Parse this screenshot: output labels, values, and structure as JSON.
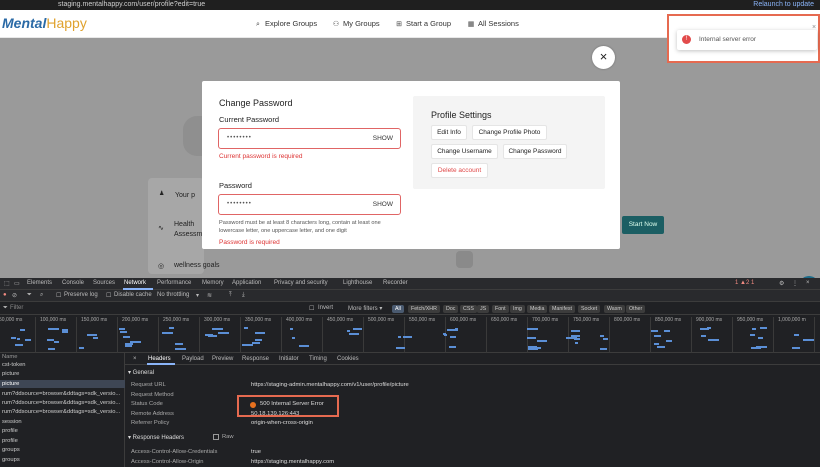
{
  "browser": {
    "url": "staging.mentalhappy.com/user/profile?edit=true",
    "relaunch": "Relaunch to update"
  },
  "site": {
    "logo_main": "Mental",
    "logo_accent": "Happy",
    "nav": [
      {
        "label": "Explore Groups",
        "icon": "search-icon"
      },
      {
        "label": "My Groups",
        "icon": "people-icon"
      },
      {
        "label": "Start a Group",
        "icon": "plus-square-icon"
      },
      {
        "label": "All Sessions",
        "icon": "calendar-icon"
      }
    ],
    "background": {
      "your_label": "Your p",
      "health_label_1": "Health",
      "health_label_2": "Assessm",
      "wellness_label": "wellness goals",
      "start_now": "Start Now"
    }
  },
  "modal": {
    "title": "Change Password",
    "current_password_label": "Current Password",
    "current_password_value": "••••••••",
    "show_label": "SHOW",
    "current_password_error": "Current password is required",
    "password_label": "Password",
    "password_value": "••••••••",
    "password_hint": "Password must be at least 8 characters long, contain at least one lowercase letter, one uppercase letter, and one digit",
    "password_error": "Password is required"
  },
  "profile_settings": {
    "title": "Profile Settings",
    "buttons": [
      "Edit Info",
      "Change Profile Photo",
      "Change Username",
      "Change Password",
      "Delete account"
    ]
  },
  "toast": {
    "message": "Internal server error",
    "icon": "!",
    "close": "×"
  },
  "devtools": {
    "tabs": [
      "Elements",
      "Console",
      "Sources",
      "Network",
      "Performance",
      "Memory",
      "Application",
      "Privacy and security",
      "Lighthouse",
      "Recorder"
    ],
    "active_tab": "Network",
    "badges": "1  ▲2  1",
    "toolbar": {
      "preserve_log": "Preserve log",
      "disable_cache": "Disable cache",
      "throttling": "No throttling"
    },
    "filter_placeholder": "Filter",
    "filter_options": [
      "Invert",
      "More filters ▾"
    ],
    "type_filters": [
      "All",
      "Fetch/XHR",
      "Doc",
      "CSS",
      "JS",
      "Font",
      "Img",
      "Media",
      "Manifest",
      "Socket",
      "Wasm",
      "Other"
    ],
    "timeline_ticks": [
      "50,000 ms",
      "100,000 ms",
      "150,000 ms",
      "200,000 ms",
      "250,000 ms",
      "300,000 ms",
      "350,000 ms",
      "400,000 ms",
      "450,000 ms",
      "500,000 ms",
      "550,000 ms",
      "600,000 ms",
      "650,000 ms",
      "700,000 ms",
      "750,000 ms",
      "800,000 ms",
      "850,000 ms",
      "900,000 ms",
      "950,000 ms",
      "1,000,000 m"
    ],
    "request_list_header": "Name",
    "requests": [
      "cst-token",
      "picture",
      "picture",
      "rum?ddsource=browser&ddtags=sdk_versio...",
      "rum?ddsource=browser&ddtags=sdk_versio...",
      "rum?ddsource=browser&ddtags=sdk_versio...",
      "session",
      "profile",
      "profile",
      "groups",
      "groups"
    ],
    "selected_request_index": 2,
    "detail_tabs": [
      "Headers",
      "Payload",
      "Preview",
      "Response",
      "Initiator",
      "Timing",
      "Cookies"
    ],
    "active_detail_tab": "Headers",
    "general_title": "▾ General",
    "general": [
      {
        "key": "Request URL",
        "value": "https://staging-admin.mentalhappy.com/v1/user/profile/picture"
      },
      {
        "key": "Request Method",
        "value": ""
      },
      {
        "key": "Status Code",
        "value": "500 Internal Server Error"
      },
      {
        "key": "Remote Address",
        "value": "50.18.139.126:443"
      },
      {
        "key": "Referrer Policy",
        "value": "origin-when-cross-origin"
      }
    ],
    "response_headers_title": "▾ Response Headers",
    "raw_label": "Raw",
    "response_headers": [
      {
        "key": "Access-Control-Allow-Credentials",
        "value": "true"
      },
      {
        "key": "Access-Control-Allow-Origin",
        "value": "https://staging.mentalhappy.com"
      }
    ]
  },
  "colors": {
    "error_red": "#e04848",
    "highlight_orange": "#e66a50",
    "brand_blue": "#2b6aa6"
  }
}
